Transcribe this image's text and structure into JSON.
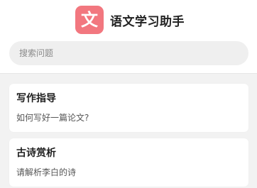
{
  "header": {
    "logo_char": "文",
    "logo_color": "#f2777f",
    "title": "语文学习助手"
  },
  "search": {
    "placeholder": "搜索问题",
    "value": ""
  },
  "cards": [
    {
      "title": "写作指导",
      "description": "如何写好一篇论文?"
    },
    {
      "title": "古诗赏析",
      "description": "请解析李白的诗"
    }
  ]
}
